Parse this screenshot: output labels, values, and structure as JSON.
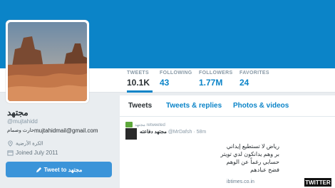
{
  "profile": {
    "name": "مجتهد",
    "handle": "@mujtahidd",
    "bio": "حارث وصمام",
    "email": "mujtahidmail@gmail.com",
    "location": "الكرة الأرضية",
    "joined": "Joined July 2011",
    "tweet_to_label": "Tweet to",
    "tweet_to_name": "مجتهد"
  },
  "stats": [
    {
      "label": "TWEETS",
      "value": "10.1K"
    },
    {
      "label": "FOLLOWING",
      "value": "43"
    },
    {
      "label": "FOLLOWERS",
      "value": "1.77M"
    },
    {
      "label": "FAVORITES",
      "value": "24"
    }
  ],
  "tabs": [
    {
      "label": "Tweets"
    },
    {
      "label": "Tweets & replies"
    },
    {
      "label": "Photos & videos"
    }
  ],
  "tweet": {
    "retweet_by": "مجتهد",
    "retweet_label": "retweeted",
    "author_name": "مجتهد دفاعته",
    "author_handle": "@MrDafsh",
    "time": "58m",
    "lines": [
      "رياض لا تستطيع إيداني",
      "بر وهم يدانكون لدي تويتر",
      "حسابي رغماً عن الوهم",
      "فضح عبادهم"
    ]
  },
  "watermark": "ibtimes.co.in",
  "badge": "TWITTER",
  "colors": {
    "accent": "#0b84c8",
    "button": "#3b94d9",
    "retweet": "#5ea83b"
  },
  "icons": {
    "bio": "handshake-icon",
    "location": "location-pin-icon",
    "joined": "calendar-icon",
    "tweet_to": "compose-icon",
    "retweet": "retweet-icon"
  }
}
